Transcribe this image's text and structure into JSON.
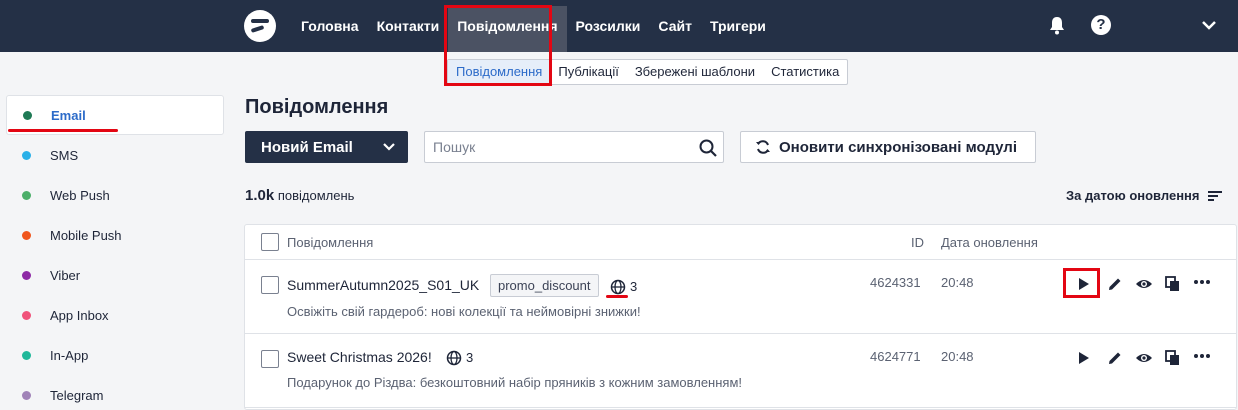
{
  "nav": {
    "items": [
      "Головна",
      "Контакти",
      "Повідомлення",
      "Розсилки",
      "Сайт",
      "Тригери"
    ],
    "active_index": 2
  },
  "subtabs": [
    "Повідомлення",
    "Публікації",
    "Збережені шаблони",
    "Статистика"
  ],
  "sidebar": {
    "items": [
      {
        "label": "Email",
        "color": "#1f7a55",
        "active": true
      },
      {
        "label": "SMS",
        "color": "#2ab0e8"
      },
      {
        "label": "Web Push",
        "color": "#4caf6a"
      },
      {
        "label": "Mobile Push",
        "color": "#f0561d"
      },
      {
        "label": "Viber",
        "color": "#8e2aa6"
      },
      {
        "label": "App Inbox",
        "color": "#f0527a"
      },
      {
        "label": "In-App",
        "color": "#20b89a"
      },
      {
        "label": "Telegram",
        "color": "#a083b8"
      }
    ]
  },
  "main": {
    "title": "Повідомлення",
    "new_button": "Новий Email",
    "search_placeholder": "Пошук",
    "sync_button": "Оновити синхронізовані модулі",
    "count_value": "1.0k",
    "count_label": "повідомлень",
    "sort_label": "За датою оновлення"
  },
  "table": {
    "headers": {
      "name": "Повідомлення",
      "id": "ID",
      "date": "Дата оновлення"
    },
    "rows": [
      {
        "name": "SummerAutumn2025_S01_UK",
        "tag": "promo_discount",
        "langs": "3",
        "subtitle": "Освіжіть свій гардероб: нові колекції та неймовірні знижки!",
        "id": "4624331",
        "date": "20:48"
      },
      {
        "name": "Sweet Christmas 2026!",
        "langs": "3",
        "subtitle": "Подарунок до Різдва: безкоштовний набір пряників з кожним замовленням!",
        "id": "4624771",
        "date": "20:48"
      }
    ]
  },
  "colors": {
    "topbar": "#243046",
    "accent": "#2c6bc9",
    "highlight": "#e30613"
  },
  "icons": [
    "logo-icon",
    "bell-icon",
    "help-icon",
    "chevron-down-icon",
    "search-icon",
    "sync-icon",
    "sort-icon",
    "globe-icon",
    "play-icon",
    "edit-icon",
    "preview-icon",
    "copy-icon",
    "more-icon"
  ]
}
